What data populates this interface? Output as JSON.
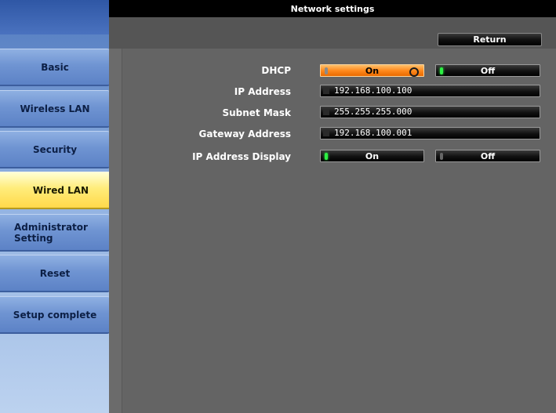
{
  "window": {
    "title": "Network settings"
  },
  "sidebar": {
    "items": [
      {
        "label": "Basic"
      },
      {
        "label": "Wireless LAN"
      },
      {
        "label": "Security"
      },
      {
        "label": "Wired LAN"
      },
      {
        "label": "Administrator\nSetting"
      },
      {
        "label": "Reset"
      },
      {
        "label": "Setup complete"
      }
    ],
    "active_index": 3
  },
  "toolbar": {
    "return_label": "Return"
  },
  "form": {
    "dhcp": {
      "label": "DHCP",
      "on_label": "On",
      "off_label": "Off",
      "selected": "On"
    },
    "ip_address": {
      "label": "IP Address",
      "value": "192.168.100.100"
    },
    "subnet_mask": {
      "label": "Subnet Mask",
      "value": "255.255.255.000"
    },
    "gateway_address": {
      "label": "Gateway Address",
      "value": "192.168.100.001"
    },
    "ip_address_display": {
      "label": "IP Address Display",
      "on_label": "On",
      "off_label": "Off",
      "selected": "Off"
    }
  },
  "icons": {
    "on_indicator": "green-led-icon",
    "off_indicator": "grey-led-icon",
    "selected_marker": "selection-ring-icon"
  },
  "colors": {
    "sidebar_blue": "#5a82c4",
    "active_tab_yellow": "#ffe264",
    "selected_toggle_orange": "#ff8a1d",
    "led_green": "#2cf043",
    "panel_gray": "#646464",
    "titlebar_black": "#000000"
  }
}
